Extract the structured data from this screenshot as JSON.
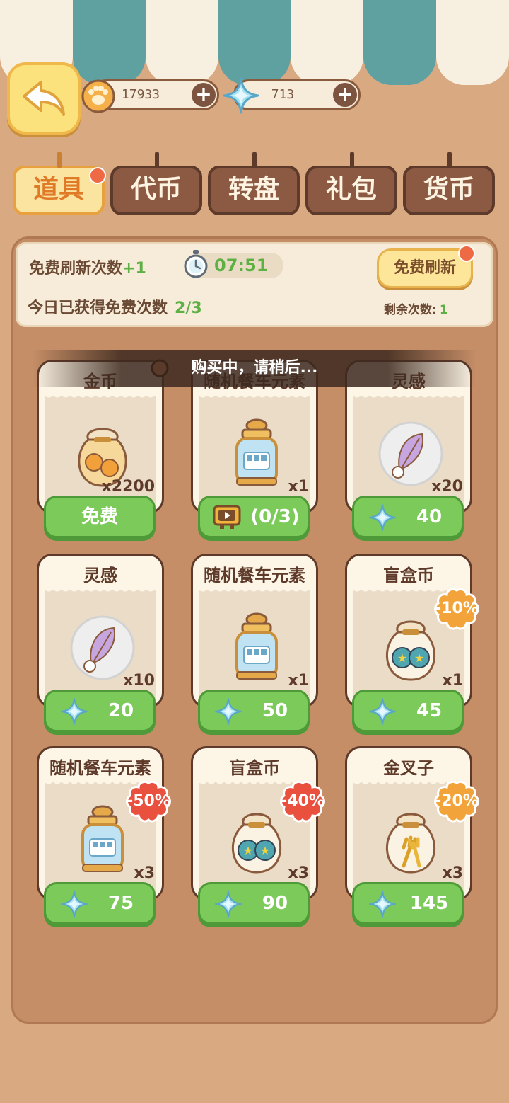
{
  "resources": {
    "paw_coins": "17933",
    "gems": "713"
  },
  "tabs": [
    {
      "label": "道具",
      "active": true,
      "has_dot": true
    },
    {
      "label": "代币",
      "active": false,
      "has_dot": false
    },
    {
      "label": "转盘",
      "active": false,
      "has_dot": false
    },
    {
      "label": "礼包",
      "active": false,
      "has_dot": false
    },
    {
      "label": "货币",
      "active": false,
      "has_dot": false
    }
  ],
  "refresh": {
    "free_refresh_label": "免费刷新次数",
    "free_refresh_plus": "+1",
    "timer": "07:51",
    "today_label": "今日已获得免费次数",
    "today_value": "2/3",
    "button": "免费刷新",
    "remaining_label": "剩余次数:",
    "remaining_value": "1"
  },
  "toast": "购买中，请稍后...",
  "items": [
    {
      "name": "金币",
      "qty": "x2200",
      "price": "免费",
      "type": "free",
      "icon": "coin-bag-icon",
      "discount": ""
    },
    {
      "name": "随机餐车元素",
      "qty": "x1",
      "price": "(0/3)",
      "type": "video",
      "icon": "food-truck-jar-icon",
      "discount": ""
    },
    {
      "name": "灵感",
      "qty": "x20",
      "price": "40",
      "type": "gem",
      "icon": "feather-bubble-icon",
      "discount": ""
    },
    {
      "name": "灵感",
      "qty": "x10",
      "price": "20",
      "type": "gem",
      "icon": "feather-bubble-icon",
      "discount": ""
    },
    {
      "name": "随机餐车元素",
      "qty": "x1",
      "price": "50",
      "type": "gem",
      "icon": "food-truck-jar-icon",
      "discount": ""
    },
    {
      "name": "盲盒币",
      "qty": "x1",
      "price": "45",
      "type": "gem",
      "icon": "blind-box-coin-bag-icon",
      "discount": "-10%"
    },
    {
      "name": "随机餐车元素",
      "qty": "x3",
      "price": "75",
      "type": "gem",
      "icon": "food-truck-jar-icon",
      "discount": "-50%"
    },
    {
      "name": "盲盒币",
      "qty": "x3",
      "price": "90",
      "type": "gem",
      "icon": "blind-box-coin-bag-icon",
      "discount": "-40%"
    },
    {
      "name": "金叉子",
      "qty": "x3",
      "price": "145",
      "type": "gem",
      "icon": "golden-fork-bag-icon",
      "discount": "-20%"
    }
  ],
  "colors": {
    "accent_green": "#5db044",
    "button_green": "#7ccb5a",
    "badge_red": "#e9503e",
    "badge_orange": "#f2a33a",
    "wood": "#8c5a43"
  }
}
